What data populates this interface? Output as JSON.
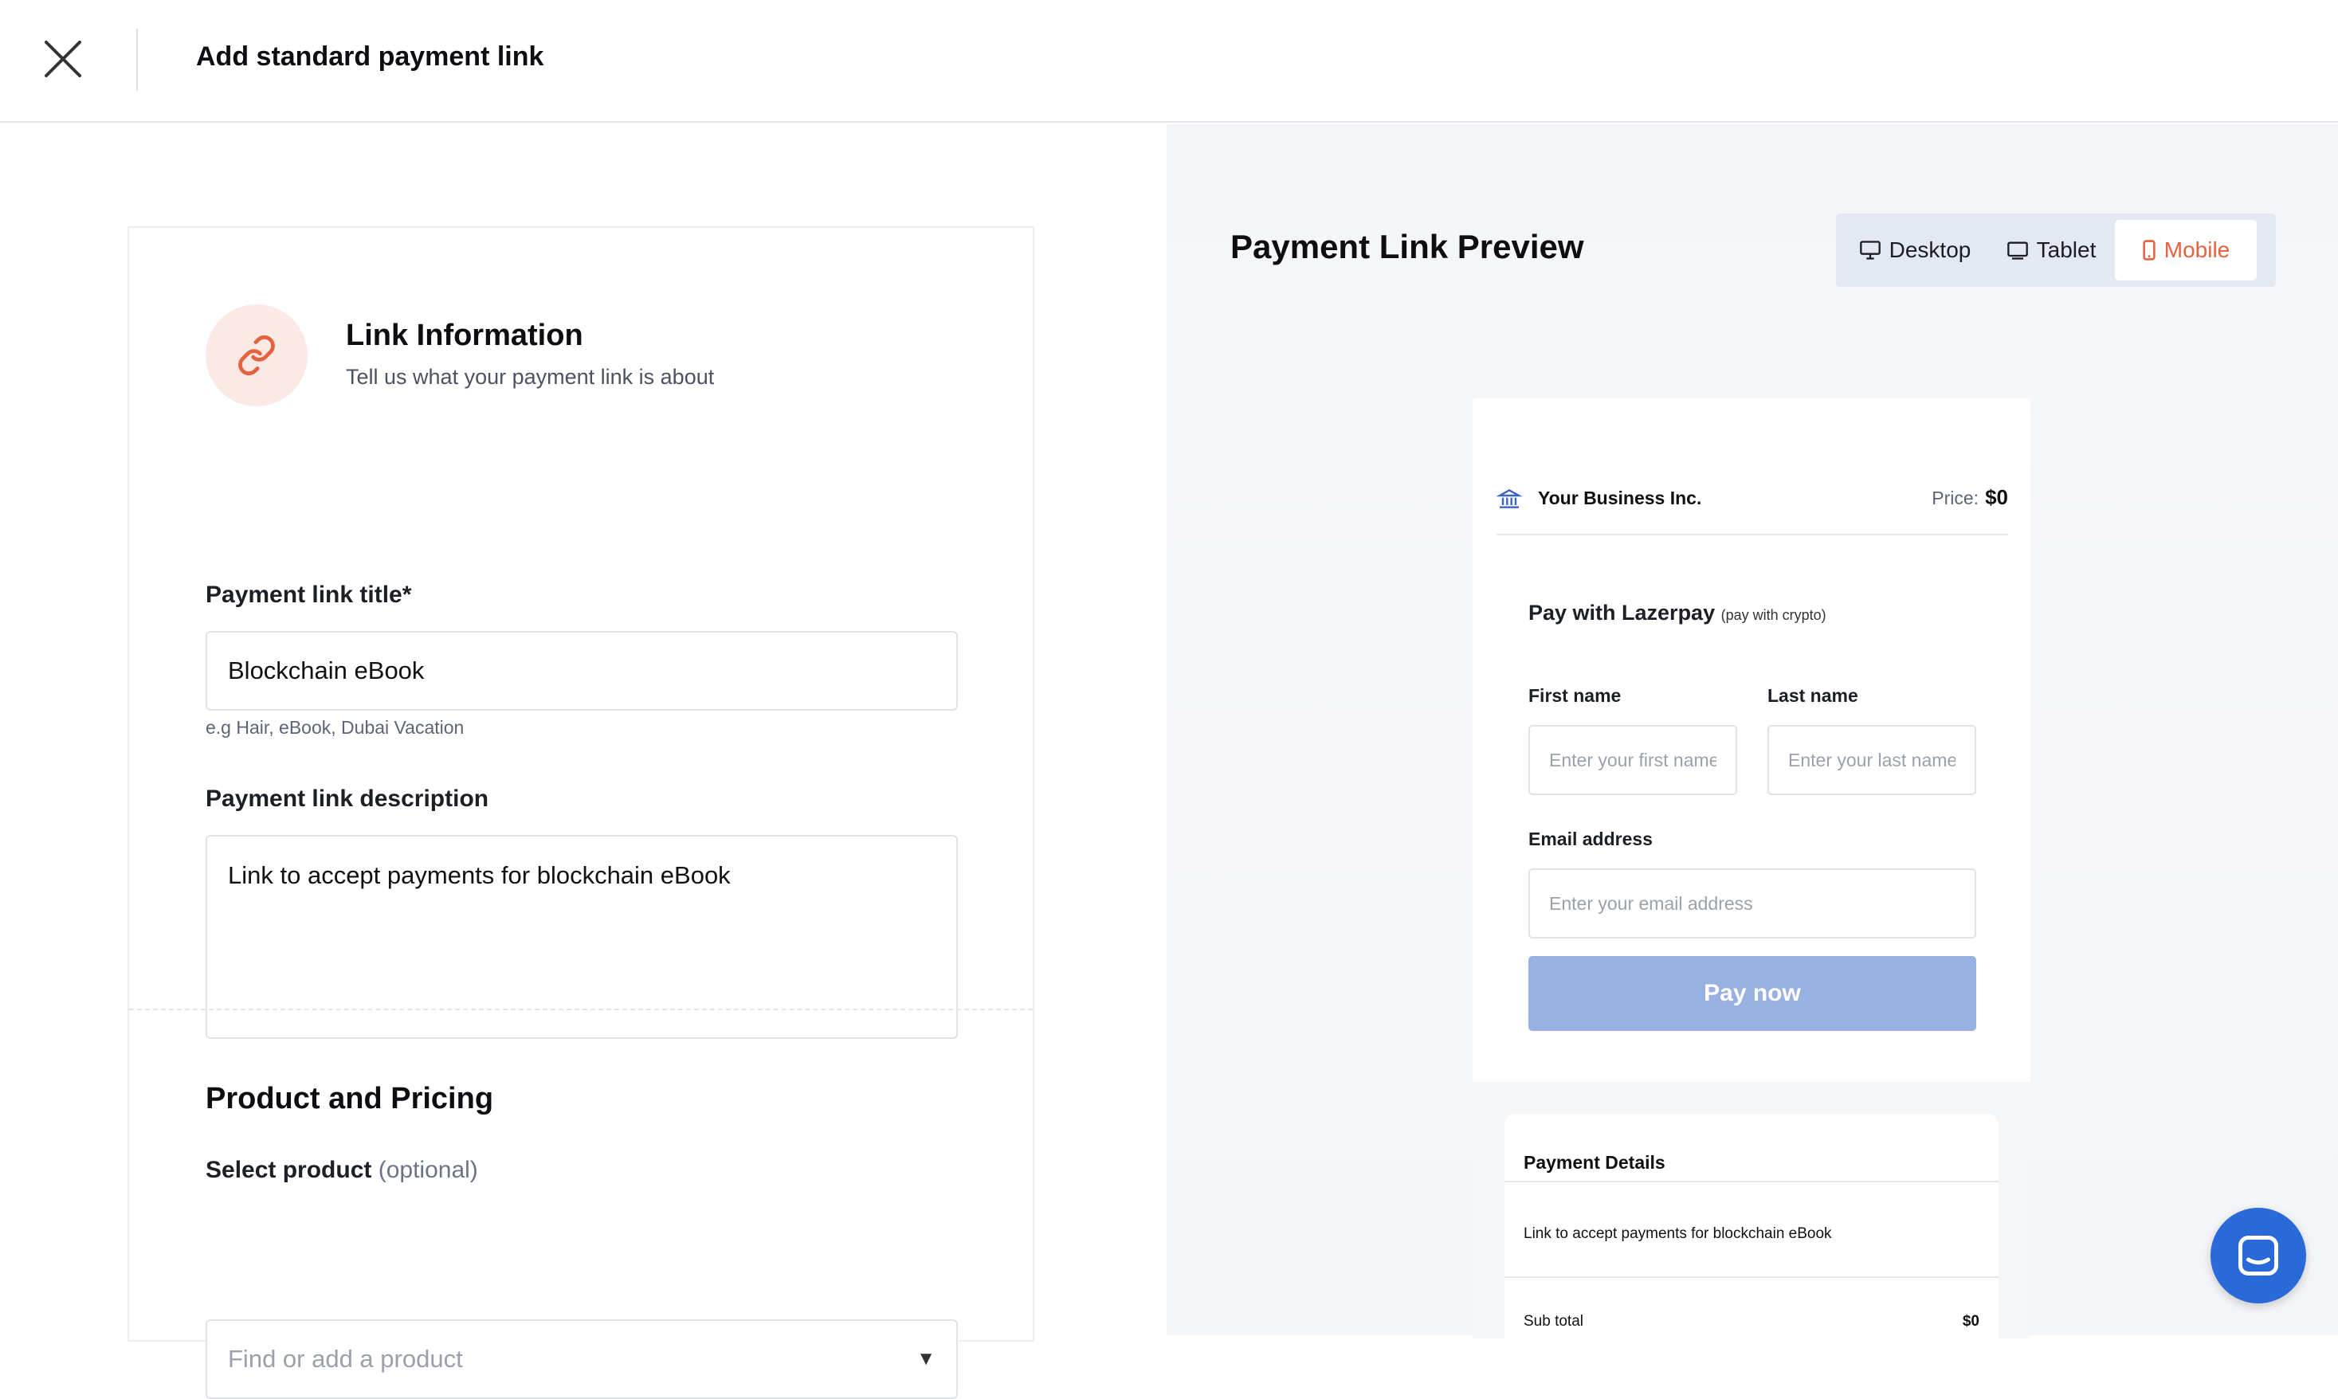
{
  "header": {
    "title": "Add standard payment link",
    "close_icon": "close-icon"
  },
  "link_info": {
    "icon": "link-icon",
    "title": "Link Information",
    "subtitle": "Tell us what your payment link is about",
    "title_label": "Payment link title*",
    "title_value": "Blockchain eBook",
    "title_hint": "e.g Hair, eBook, Dubai Vacation",
    "description_label": "Payment link description",
    "description_value": "Link to accept payments for blockchain eBook"
  },
  "product_pricing": {
    "title": "Product and Pricing",
    "select_label": "Select product",
    "select_optional": "(optional)",
    "select_placeholder": "Find or add a product",
    "select_caret": "▼"
  },
  "preview": {
    "title": "Payment Link Preview",
    "devices": {
      "desktop": "Desktop",
      "tablet": "Tablet",
      "mobile": "Mobile",
      "selected": "Mobile"
    },
    "business_name": "Your Business Inc.",
    "price_label": "Price:",
    "price_value": "$0",
    "pay_with": "Pay with Lazerpay",
    "pay_with_note": "(pay with crypto)",
    "first_name_label": "First name",
    "first_name_placeholder": "Enter your first name",
    "last_name_label": "Last name",
    "last_name_placeholder": "Enter your last name",
    "email_label": "Email address",
    "email_placeholder": "Enter your email address",
    "pay_button": "Pay now",
    "details_title": "Payment Details",
    "details_description": "Link to accept payments for blockchain eBook",
    "subtotal_label": "Sub total",
    "subtotal_value": "$0"
  },
  "colors": {
    "accent": "#e5623f",
    "pay_button": "#98b0e2",
    "chat": "#2a6ad8"
  }
}
